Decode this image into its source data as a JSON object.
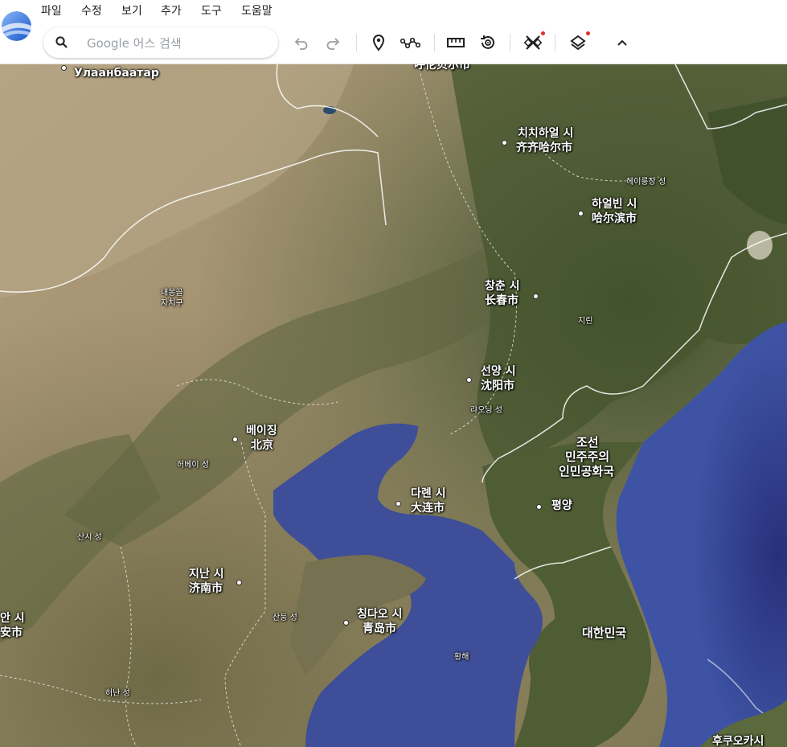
{
  "menu": [
    "파일",
    "수정",
    "보기",
    "추가",
    "도구",
    "도움말"
  ],
  "search": {
    "placeholder": "Google 어스 검색"
  },
  "toolbar": {
    "icons": [
      "undo-icon",
      "redo-icon",
      "placemark-icon",
      "path-icon",
      "ruler-icon",
      "history-icon",
      "satellite-tool-icon",
      "layers-icon",
      "collapse-icon"
    ]
  },
  "map": {
    "labels": {
      "ulaanbaatar": "Улаанбаатар",
      "hulunbuir": "呼伦贝尔市",
      "qiqihar_ko": "치치하얼 시",
      "qiqihar_zh": "齐齐哈尔市",
      "heilongjiang": "헤이룽장 성",
      "harbin_ko": "하얼빈 시",
      "harbin_zh": "哈尔滨市",
      "innermongolia_1": "내몽골",
      "innermongolia_2": "자치구",
      "changchun_ko": "창춘 시",
      "changchun_zh": "长春市",
      "jilin": "지린",
      "shenyang_ko": "선양 시",
      "shenyang_zh": "沈阳市",
      "liaoning": "랴오닝 성",
      "beijing_ko": "베이징",
      "beijing_zh": "北京",
      "hebei": "허베이 성",
      "dprk_1": "조선",
      "dprk_2": "민주주의",
      "dprk_3": "인민공화국",
      "dalian_ko": "다롄 시",
      "dalian_zh": "大连市",
      "pyongyang": "평양",
      "shanxi": "산시 성",
      "jinan_ko": "지난 시",
      "jinan_zh": "济南市",
      "xian_ko": "안 시",
      "xian_zh": "安市",
      "shandong": "산둥 성",
      "qingdao_ko": "칭다오 시",
      "qingdao_zh": "青岛市",
      "yellowsea": "황해",
      "rok": "대한민국",
      "henan": "허난 성",
      "hokkaido": "후쿠오카시"
    }
  },
  "colors": {
    "accent": "#1a73e8",
    "sea": "#3c4f9c",
    "land_north": "#a0906e",
    "land_forest": "#4d5a36"
  }
}
